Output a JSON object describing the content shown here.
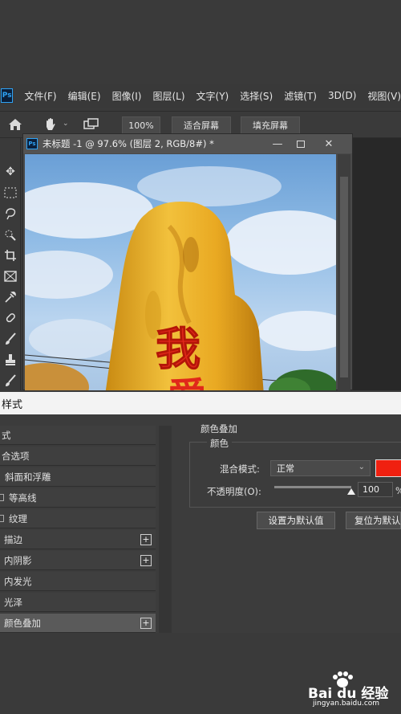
{
  "app": {
    "logo_text": "Ps"
  },
  "menu": {
    "items": [
      "文件(F)",
      "编辑(E)",
      "图像(I)",
      "图层(L)",
      "文字(Y)",
      "选择(S)",
      "滤镜(T)",
      "3D(D)",
      "视图(V)"
    ]
  },
  "options": {
    "zoom_value": "100%",
    "fit_screen": "适合屏幕",
    "fill_screen": "填充屏幕"
  },
  "document": {
    "title": "未标题 -1 @ 97.6% (图层 2, RGB/8#) *",
    "canvas_text_main": "我",
    "canvas_text_partial": "爱"
  },
  "dialog": {
    "title": "样式",
    "styles": [
      {
        "label": "式",
        "checkbox": false,
        "plus": false,
        "active": false
      },
      {
        "label": "合选项",
        "checkbox": false,
        "plus": false,
        "active": false
      },
      {
        "label": "斜面和浮雕",
        "checkbox": false,
        "plus": false,
        "active": false
      },
      {
        "label": "等高线",
        "checkbox": true,
        "plus": false,
        "active": false
      },
      {
        "label": "纹理",
        "checkbox": true,
        "plus": false,
        "active": false
      },
      {
        "label": "描边",
        "checkbox": false,
        "plus": true,
        "active": false
      },
      {
        "label": "内阴影",
        "checkbox": false,
        "plus": true,
        "active": false
      },
      {
        "label": "内发光",
        "checkbox": false,
        "plus": false,
        "active": false
      },
      {
        "label": "光泽",
        "checkbox": false,
        "plus": false,
        "active": false
      },
      {
        "label": "颜色叠加",
        "checkbox": false,
        "plus": true,
        "active": true
      }
    ],
    "section_title": "颜色叠加",
    "subsection_title": "颜色",
    "blend_mode_label": "混合模式:",
    "blend_mode_value": "正常",
    "overlay_color": "#f02010",
    "opacity_label": "不透明度(O):",
    "opacity_value": "100",
    "opacity_unit": "%",
    "opacity_fraction": 1.0,
    "set_default": "设置为默认值",
    "reset_default": "复位为默认值"
  },
  "watermark": {
    "brand": "Bai du 经验",
    "url": "jingyan.baidu.com"
  }
}
